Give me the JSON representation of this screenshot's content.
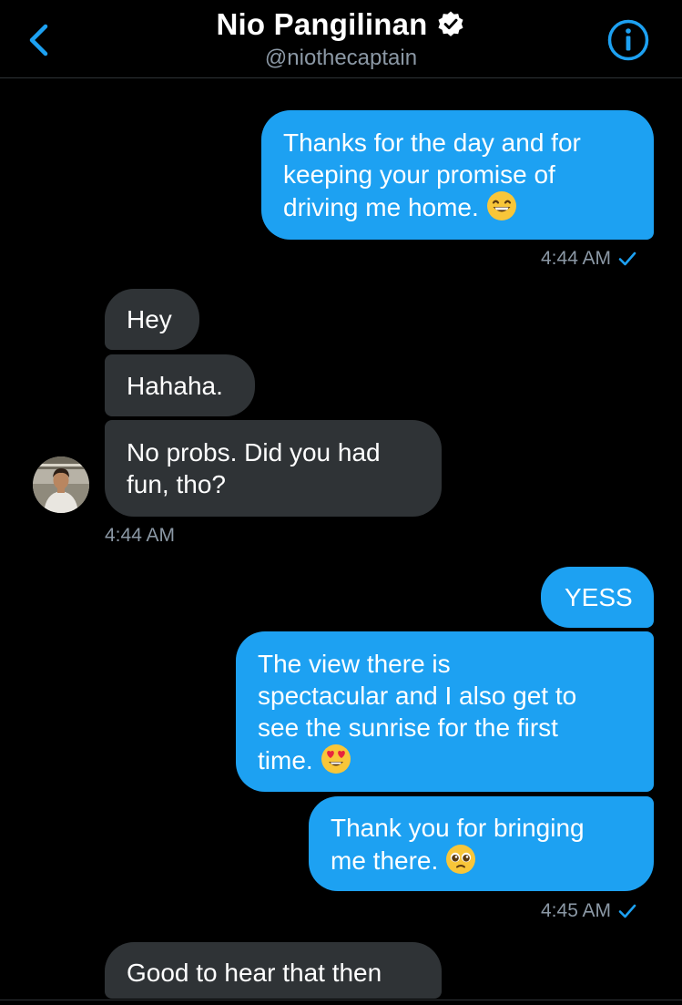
{
  "header": {
    "name": "Nio Pangilinan",
    "handle": "@niothecaptain"
  },
  "messages": [
    {
      "text": "Thanks for the day and for\nkeeping your promise of\ndriving me home.",
      "emoji": "grinning-face-with-smiling-eyes"
    },
    {
      "text": "Hey"
    },
    {
      "text": "Hahaha."
    },
    {
      "text": "No probs. Did you had\nfun, tho?"
    },
    {
      "text": "YESS"
    },
    {
      "text": "The view there is\nspectacular and I also get to\nsee the sunrise for the first\ntime.",
      "emoji": "smiling-face-with-heart-eyes"
    },
    {
      "text": "Thank you for bringing\nme there.",
      "emoji": "pleading-face"
    },
    {
      "text": "Good to hear that then"
    }
  ],
  "timestamps": [
    "4:44 AM",
    "4:44 AM",
    "4:45 AM"
  ],
  "colors": {
    "accent": "#1da1f2",
    "sent_bubble": "#1da1f2",
    "received_bubble": "#2f3336",
    "background": "#000000",
    "muted_text": "#8b98a5",
    "verified_badge": "#ffffff"
  },
  "icons": {
    "back": "chevron-left-icon",
    "verified": "verified-badge-icon",
    "info": "info-circle-icon",
    "read_receipt": "checkmark-icon"
  }
}
